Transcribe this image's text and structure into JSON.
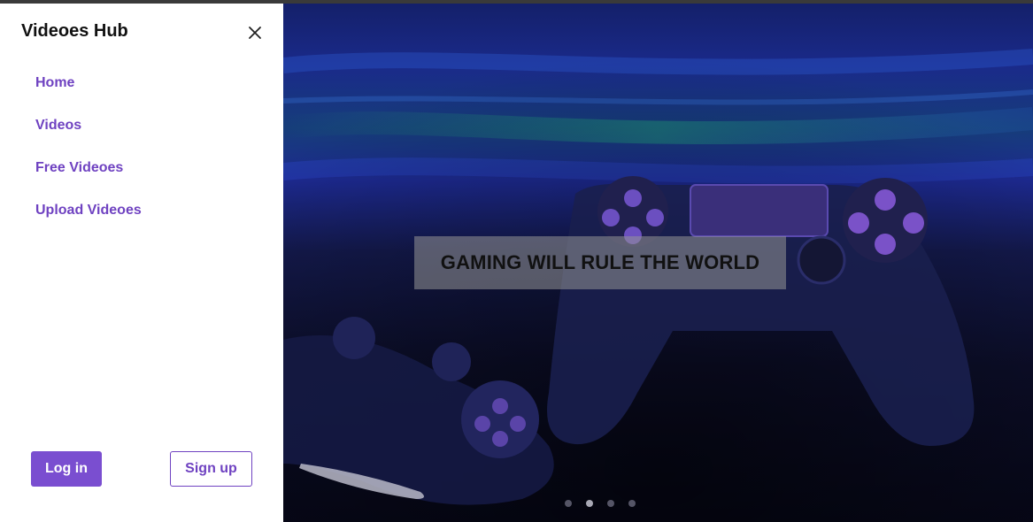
{
  "sidebar": {
    "brand": "Videoes Hub",
    "close_icon": "close-icon",
    "nav": [
      {
        "label": "Home"
      },
      {
        "label": "Videos"
      },
      {
        "label": "Free Videoes"
      },
      {
        "label": "Upload Videoes"
      }
    ],
    "login_label": "Log in",
    "signup_label": "Sign up"
  },
  "hero": {
    "caption": "GAMING WILL RULE THE WORLD",
    "slide_count": 4,
    "active_slide": 2
  },
  "colors": {
    "accent": "#6f42c1",
    "login_bg": "#7a4ed0"
  }
}
